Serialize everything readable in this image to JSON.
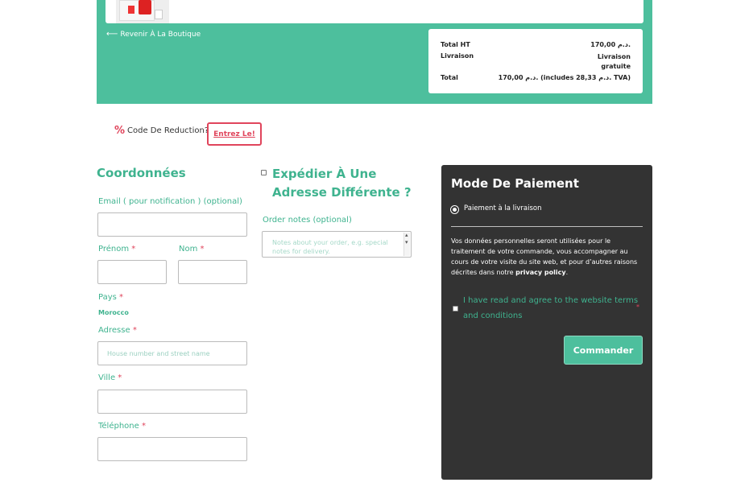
{
  "cart": {
    "back_link": "Revenir À La Boutique",
    "totals": [
      {
        "label": "Total HT",
        "value": "170,00 د.م."
      },
      {
        "label": "Livraison",
        "value": "Livraison gratuite"
      },
      {
        "label": "Total",
        "value": "170,00 د.م. (includes 28,33 د.م. TVA)"
      }
    ]
  },
  "coupon": {
    "icon": "percent-icon",
    "question": "Code De Reduction?",
    "button": "Entrez Le!"
  },
  "billing": {
    "title": "Coordonnées",
    "email_label": "Email ( pour notification ) (optional)",
    "first_name_label": "Prénom",
    "last_name_label": "Nom",
    "country_label": "Pays",
    "country_value": "Morocco",
    "address_label": "Adresse",
    "address_placeholder": "House number and street name",
    "city_label": "Ville",
    "phone_label": "Téléphone",
    "required_mark": "*"
  },
  "shipping": {
    "title": "Expédier À Une Adresse Différente ?",
    "notes_label": "Order notes (optional)",
    "notes_placeholder": "Notes about your order, e.g. special notes for delivery."
  },
  "payment": {
    "title": "Mode De Paiement",
    "method": "Paiement à la livraison",
    "privacy_text": "Vos données personnelles seront utilisées pour le traitement de votre commande, vous accompagner au cours de votre visite du site web, et pour d’autres raisons décrites dans notre ",
    "privacy_link": "privacy policy",
    "privacy_end": ".",
    "terms": "I have read and agree to the website terms and conditions",
    "terms_req": "*",
    "order_button": "Commander"
  },
  "colors": {
    "accent": "#4dbf9d",
    "accent_text": "#3fb38f",
    "danger": "#e0455c",
    "panel_dark": "#333333"
  }
}
